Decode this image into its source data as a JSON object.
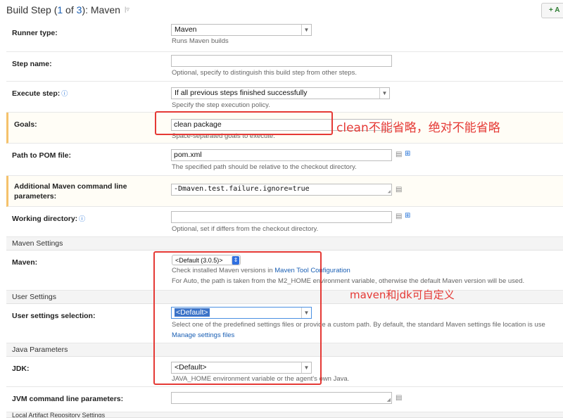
{
  "header": {
    "title_prefix": "Build Step (",
    "step_current": "1",
    "title_of": " of ",
    "step_total": "3",
    "title_suffix": "): Maven",
    "add_label": "+ A"
  },
  "runner_type": {
    "label": "Runner type:",
    "value": "Maven",
    "hint": "Runs Maven builds"
  },
  "step_name": {
    "label": "Step name:",
    "value": "",
    "hint": "Optional, specify to distinguish this build step from other steps."
  },
  "execute_step": {
    "label": "Execute step:",
    "value": "If all previous steps finished successfully",
    "hint": "Specify the step execution policy."
  },
  "goals": {
    "label": "Goals:",
    "value": "clean package",
    "hint": "Space-separated goals to execute."
  },
  "pom": {
    "label": "Path to POM file:",
    "value": "pom.xml",
    "hint": "The specified path should be relative to the checkout directory."
  },
  "additional": {
    "label": "Additional Maven command line parameters:",
    "value": "-Dmaven.test.failure.ignore=true"
  },
  "working_dir": {
    "label": "Working directory:",
    "value": "",
    "hint": "Optional, set if differs from the checkout directory."
  },
  "maven_settings": {
    "section": "Maven Settings",
    "label": "Maven:",
    "value": "<Default (3.0.5)>",
    "hint_prefix": "Check installed Maven versions in ",
    "hint_link": "Maven Tool Configuration",
    "hint2": "For Auto, the path is taken from the M2_HOME environment variable, otherwise the default Maven version will be used."
  },
  "user_settings": {
    "section": "User Settings",
    "label": "User settings selection:",
    "value": "<Default>",
    "hint": "Select one of the predefined settings files or provide a custom path. By default, the standard Maven settings file location is use",
    "link": "Manage settings files"
  },
  "java_params": {
    "section": "Java Parameters",
    "jdk_label": "JDK:",
    "jdk_value": "<Default>",
    "jdk_hint": "JAVA_HOME environment variable or the agent's own Java.",
    "jvm_label": "JVM command line parameters:",
    "jvm_value": ""
  },
  "local_repo": {
    "section": "Local Artifact Repository Settings"
  },
  "annotations": {
    "goals_note": "clean不能省略，绝对不能省略",
    "maven_note": "maven和jdk可自定义"
  },
  "icons": {
    "help": "question-circle-icon",
    "dropdown": "chevron-down-icon",
    "text_editor": "text-editor-icon",
    "tree": "directory-tree-icon",
    "grip": "resize-grip-icon"
  },
  "colors": {
    "link": "#1a5fb4",
    "annotation": "#e53935",
    "highlight_border": "#f5c26b"
  }
}
